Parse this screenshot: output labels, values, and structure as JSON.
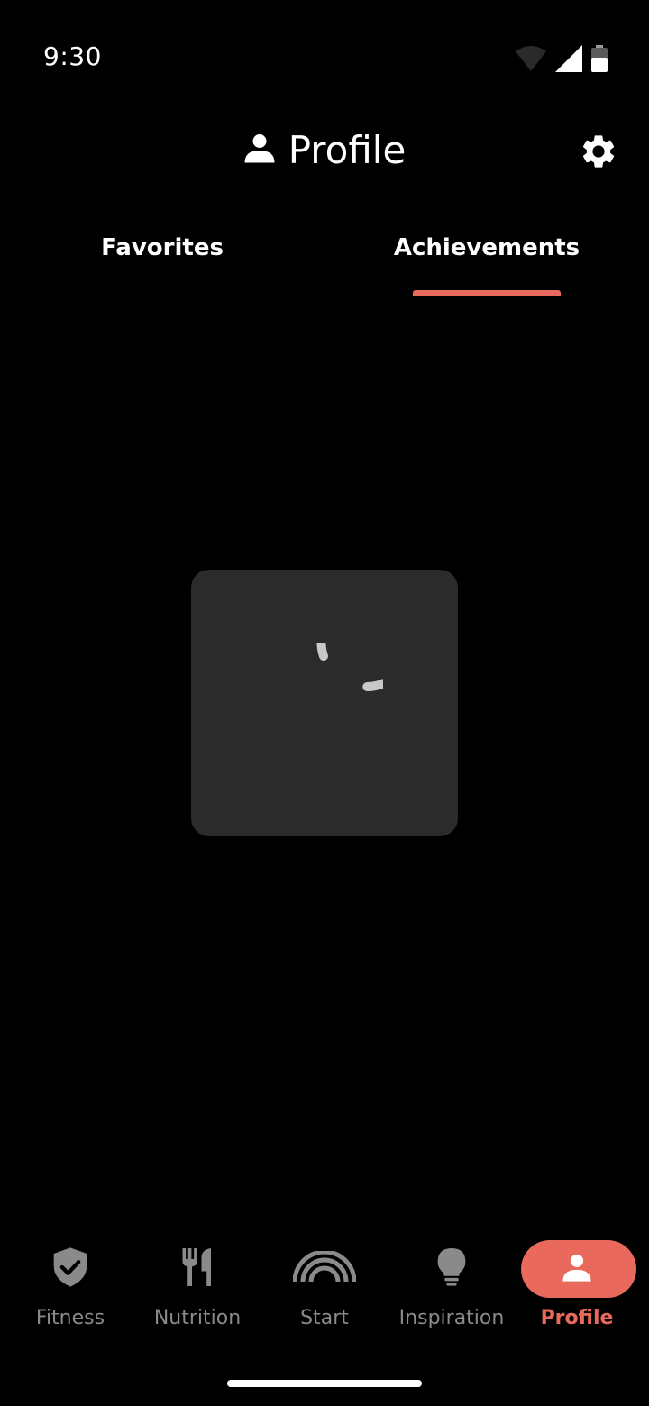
{
  "status_bar": {
    "time": "9:30",
    "icons": [
      "wifi-icon",
      "signal-icon",
      "battery-icon"
    ]
  },
  "header": {
    "title": "Profile",
    "title_icon": "person-icon",
    "settings_icon": "gear-icon"
  },
  "tabs": [
    {
      "label": "Favorites",
      "active": false
    },
    {
      "label": "Achievements",
      "active": true
    }
  ],
  "loading": {
    "icon": "spinner-icon"
  },
  "bottom_nav": {
    "items": [
      {
        "label": "Fitness",
        "icon": "shield-check-icon",
        "active": false
      },
      {
        "label": "Nutrition",
        "icon": "fork-knife-icon",
        "active": false
      },
      {
        "label": "Start",
        "icon": "rainbow-icon",
        "active": false
      },
      {
        "label": "Inspiration",
        "icon": "lightbulb-icon",
        "active": false
      },
      {
        "label": "Profile",
        "icon": "person-icon",
        "active": true
      }
    ]
  },
  "colors": {
    "accent": "#e96a5c",
    "background": "#000000",
    "card": "#2b2b2b",
    "inactive": "#8a8a8a"
  }
}
